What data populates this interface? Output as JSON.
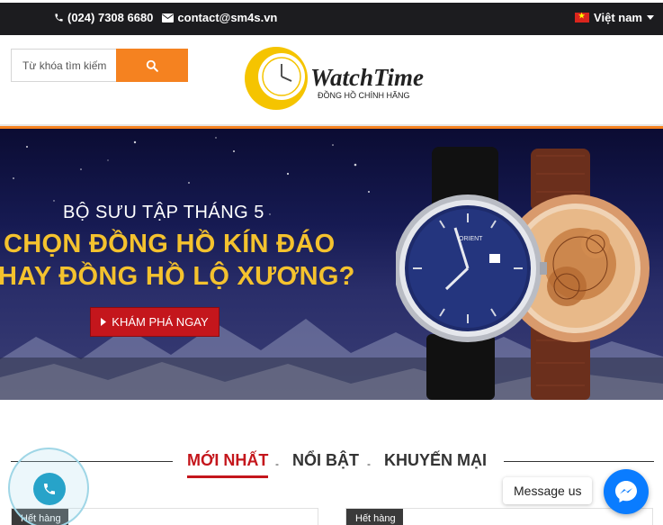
{
  "topbar": {
    "phone": "(024) 7308 6680",
    "email": "contact@sm4s.vn",
    "language": "Việt nam"
  },
  "header": {
    "search": {
      "placeholder": "Từ khóa tìm kiếm"
    },
    "logo": {
      "brand": "WatchTime",
      "tagline": "ĐỒNG HỒ CHÍNH HÃNG"
    }
  },
  "banner": {
    "subtitle": "BỘ SƯU TẬP THÁNG 5",
    "headline_1": "CHỌN ĐỒNG HỒ KÍN ĐÁO",
    "headline_2": "HAY ĐỒNG HỒ LỘ XƯƠNG?",
    "cta": "KHÁM PHÁ NGAY",
    "watch_brand": "ORIENT"
  },
  "tabs": [
    {
      "label": "MỚI NHẤT",
      "active": true
    },
    {
      "label": "NỔI BẬT",
      "active": false
    },
    {
      "label": "KHUYẾN MẠI",
      "active": false
    }
  ],
  "products": [
    {
      "badge": "Hết hàng"
    },
    {
      "badge": "Hết hàng"
    }
  ],
  "widgets": {
    "messenger_label": "Message us"
  },
  "colors": {
    "accent": "#f58220",
    "tab_active": "#c4161c",
    "headline": "#f4c22e",
    "topbar": "#1c1c1f",
    "messenger": "#0a7cff",
    "call": "#27a3c9"
  }
}
